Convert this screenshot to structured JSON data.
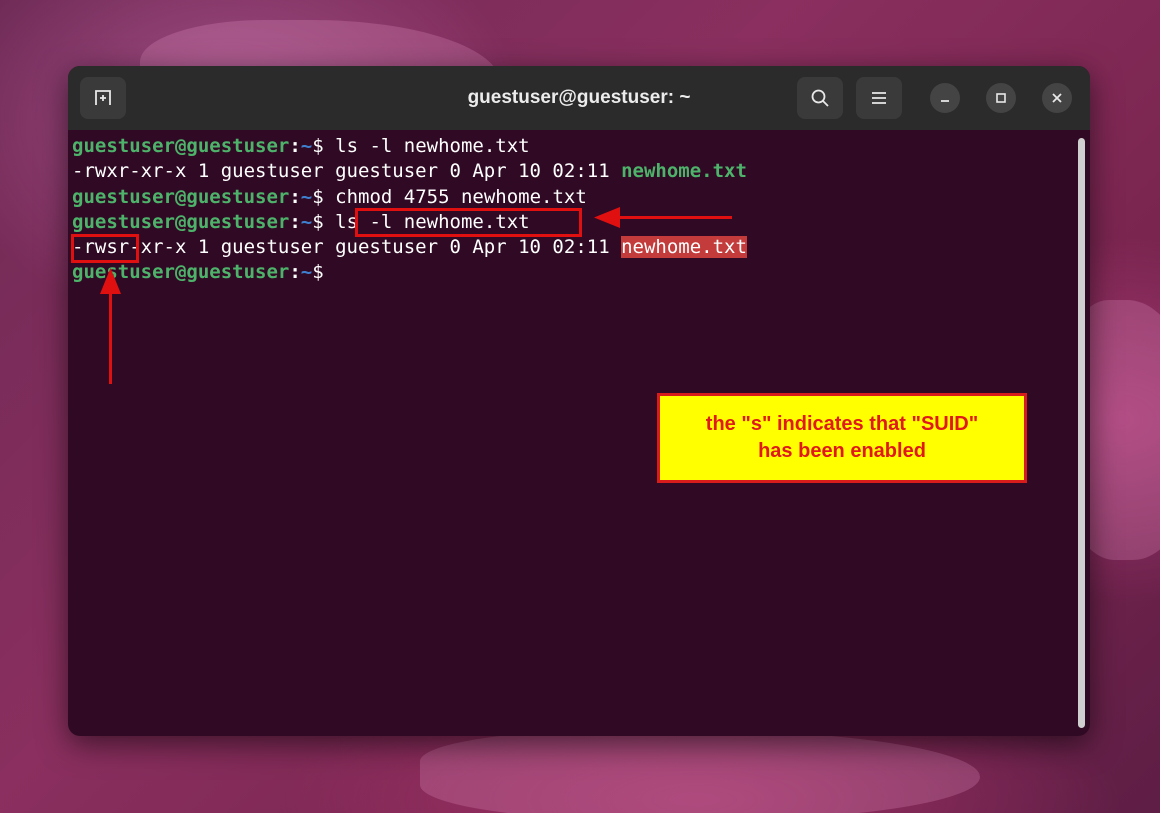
{
  "window": {
    "title": "guestuser@guestuser: ~",
    "buttons": {
      "new_tab_icon": "new-tab-icon",
      "search_icon": "search-icon",
      "menu_icon": "hamburger-menu-icon",
      "minimize_icon": "minimize-icon",
      "maximize_icon": "maximize-icon",
      "close_icon": "close-icon"
    }
  },
  "terminal": {
    "prompt_user": "guestuser@guestuser",
    "prompt_colon": ":",
    "prompt_path": "~",
    "prompt_dollar": "$",
    "lines": [
      {
        "cmd": " ls -l newhome.txt"
      },
      {
        "out": "-rwxr-xr-x 1 guestuser guestuser 0 Apr 10 02:11 ",
        "file": "newhome.txt"
      },
      {
        "cmd": " chmod 4755 newhome.txt"
      },
      {
        "cmd": " ls -l newhome.txt"
      },
      {
        "out": "-rwsr-xr-x 1 guestuser guestuser 0 Apr 10 02:11 ",
        "file": "newhome.txt"
      },
      {
        "cmd": ""
      }
    ]
  },
  "annotation": {
    "line1": "the \"s\" indicates that \"SUID\"",
    "line2": "has been enabled",
    "color_box": "#ffff00",
    "color_accent": "#e01010"
  }
}
